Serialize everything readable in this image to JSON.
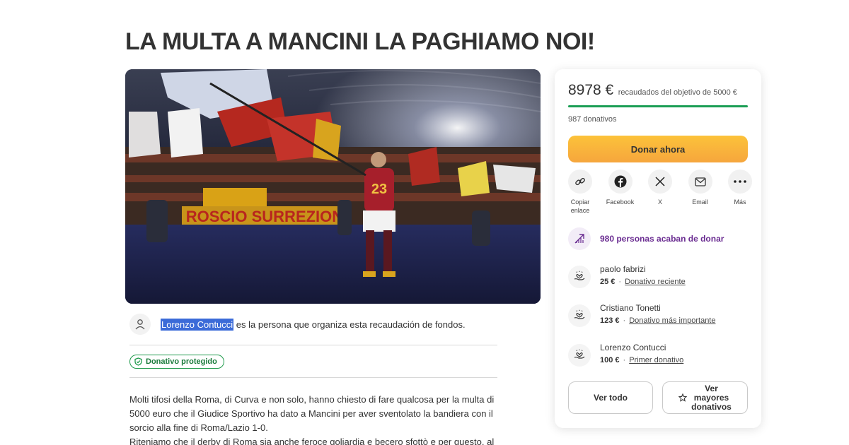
{
  "page": {
    "title": "LA MULTA A MANCINI LA PAGHIAMO NOI!"
  },
  "organizer": {
    "name": "Lorenzo Contucci",
    "text": " es la persona que organiza esta recaudación de fondos."
  },
  "badge": {
    "label": "Donativo protegido"
  },
  "story": {
    "lines": [
      "Molti tifosi della Roma, di Curva e non solo, hanno chiesto di fare qualcosa per la multa di",
      "5000 euro che il Giudice Sportivo ha dato a Mancini per aver sventolato la bandiera con il",
      "sorcio alla fine di Roma/Lazio 1-0.",
      "Riteniamo che il derby di Roma sia anche feroce goliardia e becero sfottò e per questo, al di"
    ]
  },
  "hero_banner": {
    "text": "ROSCIO SURREZIONI"
  },
  "card": {
    "amount": "8978 €",
    "goal_text": "recaudados del objetivo de 5000 €",
    "progress_fraction": 1.0,
    "donations_count": "987 donativos",
    "donate_label": "Donar ahora",
    "shares": [
      {
        "label": "Copiar enlace",
        "icon": "link-icon"
      },
      {
        "label": "Facebook",
        "icon": "facebook-icon"
      },
      {
        "label": "X",
        "icon": "x-icon"
      },
      {
        "label": "Email",
        "icon": "email-icon"
      },
      {
        "label": "Más",
        "icon": "more-icon"
      }
    ],
    "recent_text": "980 personas acaban de donar",
    "donors": [
      {
        "name": "paolo fabrizi",
        "amount": "25 €",
        "tag": "Donativo reciente"
      },
      {
        "name": "Cristiano Tonetti",
        "amount": "123 €",
        "tag": "Donativo más importante"
      },
      {
        "name": "Lorenzo Contucci",
        "amount": "100 €",
        "tag": "Primer donativo"
      }
    ],
    "see_all_label": "Ver todo",
    "top_donors_label": [
      "Ver",
      "mayores",
      "donativos"
    ]
  },
  "colors": {
    "accent_green": "#1a9e54",
    "donate_orange": "#f6a63d",
    "recent_purple": "#6a2c91"
  }
}
